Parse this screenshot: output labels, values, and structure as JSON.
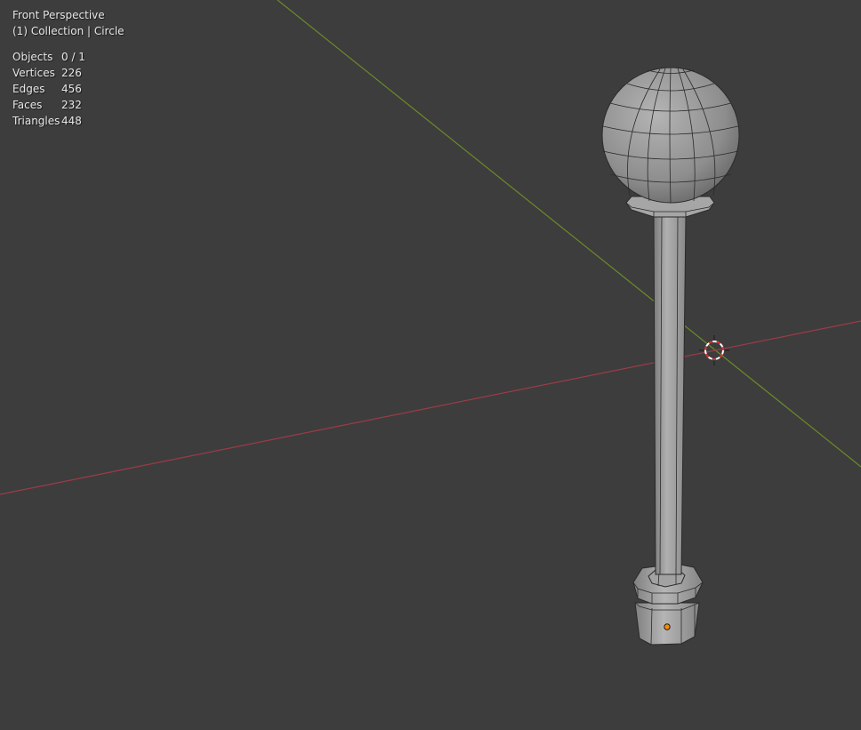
{
  "viewport": {
    "view_name": "Front Perspective",
    "collection_info": "(1) Collection | Circle",
    "background_color": "#3d3d3d"
  },
  "stats": [
    {
      "label": "Objects",
      "value": "0 / 1"
    },
    {
      "label": "Vertices",
      "value": "226"
    },
    {
      "label": "Edges",
      "value": "456"
    },
    {
      "label": "Faces",
      "value": "232"
    },
    {
      "label": "Triangles",
      "value": "448"
    }
  ],
  "colors": {
    "x_axis": "#9c3b47",
    "y_axis": "#6b8a2a",
    "mesh_fill": "#9a9a9a",
    "mesh_edge": "#2a2a2a",
    "origin_dot": "#ff8c00",
    "cursor_red": "#d33",
    "cursor_white": "#ffffff"
  },
  "icons": {
    "cursor": "3d-cursor-icon",
    "origin": "object-origin-icon"
  }
}
